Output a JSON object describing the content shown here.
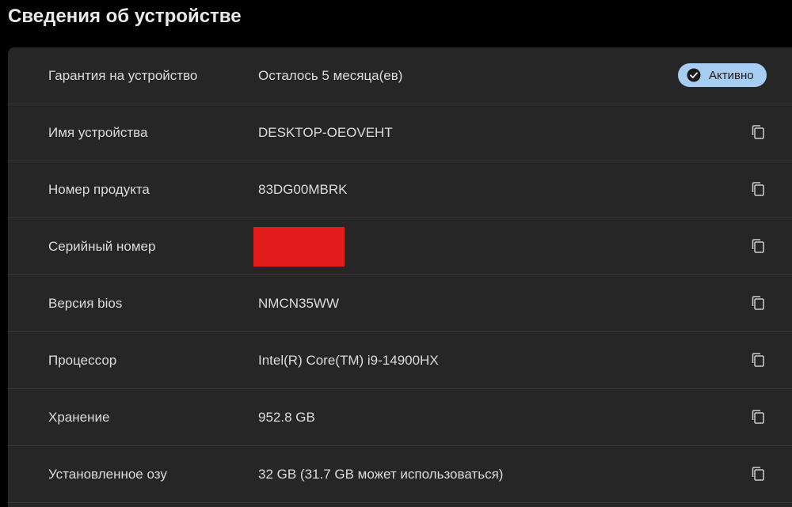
{
  "page": {
    "title": "Сведения об устройстве"
  },
  "colors": {
    "background": "#000000",
    "panel": "#262626",
    "divider": "#3b3b3b",
    "badge_bg": "#a7cdf2",
    "redaction": "#e31c1c"
  },
  "rows": [
    {
      "label": "Гарантия на устройство",
      "value": "Осталось 5 месяца(ев)",
      "badge": "Активно",
      "badge_icon": "check-circle-icon"
    },
    {
      "label": "Имя устройства",
      "value": "DESKTOP-OEOVEHT",
      "icon": "copy-icon"
    },
    {
      "label": "Номер продукта",
      "value": "83DG00MBRK",
      "icon": "copy-icon"
    },
    {
      "label": "Серийный номер",
      "value": "",
      "redacted": true,
      "icon": "copy-icon"
    },
    {
      "label": "Версия bios",
      "value": "NMCN35WW",
      "icon": "copy-icon"
    },
    {
      "label": "Процессор",
      "value": "Intel(R) Core(TM) i9-14900HX",
      "icon": "copy-icon"
    },
    {
      "label": "Хранение",
      "value": "952.8 GB",
      "icon": "copy-icon"
    },
    {
      "label": "Установленное озу",
      "value": "32 GB (31.7 GB может использоваться)",
      "icon": "copy-icon"
    }
  ]
}
